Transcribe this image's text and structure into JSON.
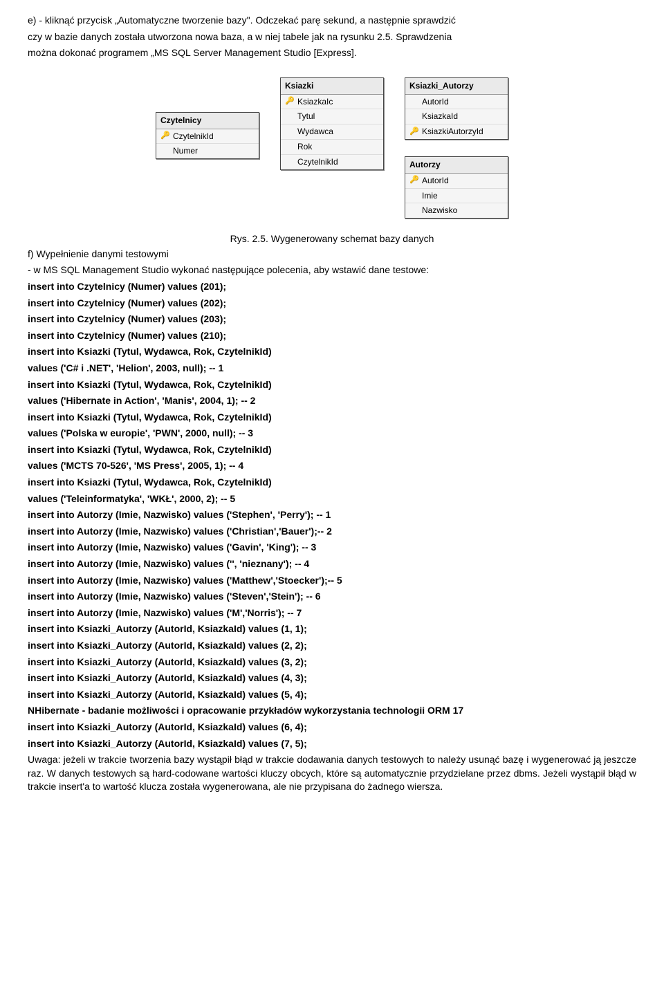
{
  "intro": {
    "p1": "e) - kliknąć przycisk „Automatyczne tworzenie bazy\". Odczekać parę sekund, a następnie sprawdzić",
    "p2": "czy w bazie danych została utworzona nowa baza, a w niej tabele jak na rysunku 2.5. Sprawdzenia",
    "p3": "można dokonać programem „MS SQL Server Management Studio [Express]."
  },
  "diagram": {
    "czytelnicy": {
      "title": "Czytelnicy",
      "rows": [
        "CzytelnikId",
        "Numer"
      ]
    },
    "ksiazki": {
      "title": "Ksiazki",
      "rows": [
        "KsiazkaIc",
        "Tytul",
        "Wydawca",
        "Rok",
        "CzytelnikId"
      ]
    },
    "ksiazki_autorzy": {
      "title": "Ksiazki_Autorzy",
      "rows": [
        "AutorId",
        "KsiazkaId",
        "KsiazkiAutorzyId"
      ]
    },
    "autorzy": {
      "title": "Autorzy",
      "rows": [
        "AutorId",
        "Imie",
        "Nazwisko"
      ]
    }
  },
  "figcap": "Rys. 2.5. Wygenerowany schemat bazy danych",
  "body": {
    "l1": "f) Wypełnienie danymi testowymi",
    "l2": "- w MS SQL Management Studio wykonać następujące polecenia, aby wstawić dane testowe:",
    "l3": "insert into Czytelnicy (Numer) values (201);",
    "l4": "insert into Czytelnicy (Numer) values (202);",
    "l5": "insert into Czytelnicy (Numer) values (203);",
    "l6": "insert into Czytelnicy (Numer) values (210);",
    "l7": "insert into Ksiazki (Tytul, Wydawca, Rok, CzytelnikId)",
    "l8": "values ('C# i .NET', 'Helion', 2003, null); -- 1",
    "l9": "insert into Ksiazki (Tytul, Wydawca, Rok, CzytelnikId)",
    "l10": "values ('Hibernate in Action', 'Manis', 2004, 1); -- 2",
    "l11": "insert into Ksiazki (Tytul, Wydawca, Rok, CzytelnikId)",
    "l12": "values ('Polska w europie', 'PWN', 2000, null); -- 3",
    "l13": "insert into Ksiazki (Tytul, Wydawca, Rok, CzytelnikId)",
    "l14": "values ('MCTS 70-526', 'MS Press', 2005, 1); -- 4",
    "l15": "insert into Ksiazki (Tytul, Wydawca, Rok, CzytelnikId)",
    "l16": "values ('Teleinformatyka', 'WKŁ', 2000, 2); -- 5",
    "l17": "insert into Autorzy (Imie, Nazwisko) values ('Stephen', 'Perry'); -- 1",
    "l18": "insert into Autorzy (Imie, Nazwisko) values ('Christian','Bauer');-- 2",
    "l19": "insert into Autorzy (Imie, Nazwisko) values ('Gavin', 'King'); -- 3",
    "l20": "insert into Autorzy (Imie, Nazwisko) values ('', 'nieznany'); -- 4",
    "l21": "insert into Autorzy (Imie, Nazwisko) values ('Matthew','Stoecker');-- 5",
    "l22": "insert into Autorzy (Imie, Nazwisko) values ('Steven','Stein'); -- 6",
    "l23": "insert into Autorzy (Imie, Nazwisko) values ('M','Norris'); -- 7",
    "l24": "insert into Ksiazki_Autorzy (AutorId, KsiazkaId) values (1, 1);",
    "l25": "insert into Ksiazki_Autorzy (AutorId, KsiazkaId) values (2, 2);",
    "l26": "insert into Ksiazki_Autorzy (AutorId, KsiazkaId) values (3, 2);",
    "l27": "insert into Ksiazki_Autorzy (AutorId, KsiazkaId) values (4, 3);",
    "l28": "insert into Ksiazki_Autorzy (AutorId, KsiazkaId) values (5, 4);",
    "l29": "NHibernate - badanie możliwości i opracowanie przykładów wykorzystania technologii ORM 17",
    "l30": "insert into Ksiazki_Autorzy (AutorId, KsiazkaId) values (6, 4);",
    "l31": "insert into Ksiazki_Autorzy (AutorId, KsiazkaId) values (7, 5);",
    "p_end": "Uwaga: jeżeli w trakcie tworzenia bazy wystąpił błąd w trakcie dodawania danych testowych to należy usunąć bazę i wygenerować ją jeszcze raz. W danych testowych są hard-codowane wartości kluczy obcych, które są automatycznie przydzielane przez dbms. Jeżeli wystąpił błąd w trakcie insert'a to wartość klucza została wygenerowana, ale nie przypisana do żadnego wiersza."
  }
}
